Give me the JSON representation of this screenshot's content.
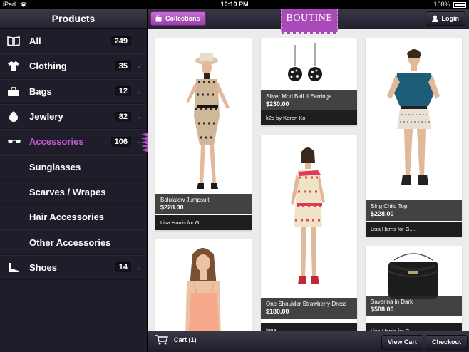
{
  "status": {
    "device": "iPad",
    "time": "10:10 PM",
    "battery": "100%"
  },
  "sidebar": {
    "title": "Products",
    "items": [
      {
        "label": "All",
        "count": "249",
        "icon": "book-icon",
        "has_chevron": false
      },
      {
        "label": "Clothing",
        "count": "35",
        "icon": "shirt-icon",
        "has_chevron": true
      },
      {
        "label": "Bags",
        "count": "12",
        "icon": "bag-icon",
        "has_chevron": true
      },
      {
        "label": "Jewlery",
        "count": "82",
        "icon": "jewelry-icon",
        "has_chevron": true
      },
      {
        "label": "Accessories",
        "count": "106",
        "icon": "sunglasses-icon",
        "has_chevron": true,
        "active": true
      },
      {
        "label": "Sunglasses",
        "sub": true
      },
      {
        "label": "Scarves / Wrapes",
        "sub": true
      },
      {
        "label": "Hair Accessories",
        "sub": true
      },
      {
        "label": "Other Accessories",
        "sub": true
      },
      {
        "label": "Shoes",
        "count": "14",
        "icon": "shoe-icon",
        "has_chevron": true
      }
    ]
  },
  "header": {
    "collections_label": "Collections",
    "logo": "BOUTINE",
    "login_label": "Login"
  },
  "products": [
    {
      "name": "Balulalow Jumpsuit",
      "price": "$228.00",
      "brand": "Lisa Harris for G...."
    },
    {
      "name": "Silver Mod Ball II Earrings",
      "price": "$230.00",
      "brand": "k2o by Karen Ko"
    },
    {
      "name": "Sing Child Top",
      "price": "$228.00",
      "brand": "Lisa Harris for G...."
    },
    {
      "name": "One Shoulder Strawberry Dress",
      "price": "$180.00",
      "brand": "Inna"
    },
    {
      "name": "Saverina in Dark",
      "price": "$588.00",
      "brand": "Lisa Harris for G...."
    }
  ],
  "footer": {
    "cart_label": "Cart (1)",
    "view_cart_label": "View Cart",
    "checkout_label": "Checkout"
  },
  "colors": {
    "accent": "#b04dbc",
    "sidebar_bg": "#1f1d2a",
    "content_bg": "#ececec"
  }
}
